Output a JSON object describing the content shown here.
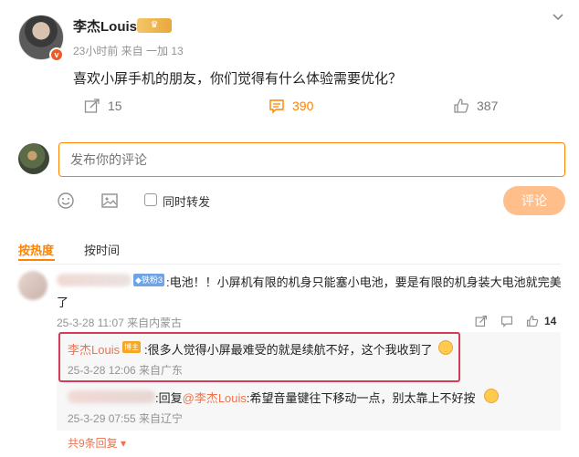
{
  "post": {
    "author": "李杰Louis",
    "crown_badge": "♛",
    "vip_mark": "v",
    "meta": "23小时前 来自 一加 13",
    "text": "喜欢小屏手机的朋友，你们觉得有什么体验需要优化？",
    "menu_icon": "chevron-down-icon",
    "share_count": "15",
    "comment_count": "390",
    "like_count": "387"
  },
  "composer": {
    "placeholder": "发布你的评论",
    "repost_label": "同时转发",
    "submit_label": "评论"
  },
  "sort": {
    "hot": "按热度",
    "time": "按时间"
  },
  "comments": [
    {
      "fan_badge": "◆铁粉3",
      "text": ":电池！！小屏机有限的机身只能塞小电池，要是有限的机身装大电池就完美了",
      "meta": "25-3-28 11:07 来自内蒙古",
      "likes": "14",
      "replies": [
        {
          "author": "李杰Louis",
          "badge": "博主",
          "text": ":很多人觉得小屏最难受的就是续航不好，这个我收到了",
          "meta": "25-3-28 12:06 来自广东"
        },
        {
          "text_prefix": ":回复",
          "mention": "@李杰Louis",
          "text_suffix": ":希望音量键往下移动一点，别太靠上不好按",
          "meta": "25-3-29 07:55 来自辽宁"
        }
      ],
      "more_label": "共9条回复 ▾"
    }
  ],
  "colors": {
    "accent": "#ff8200",
    "name_link": "#eb7350",
    "highlight_border": "#d23d55"
  }
}
